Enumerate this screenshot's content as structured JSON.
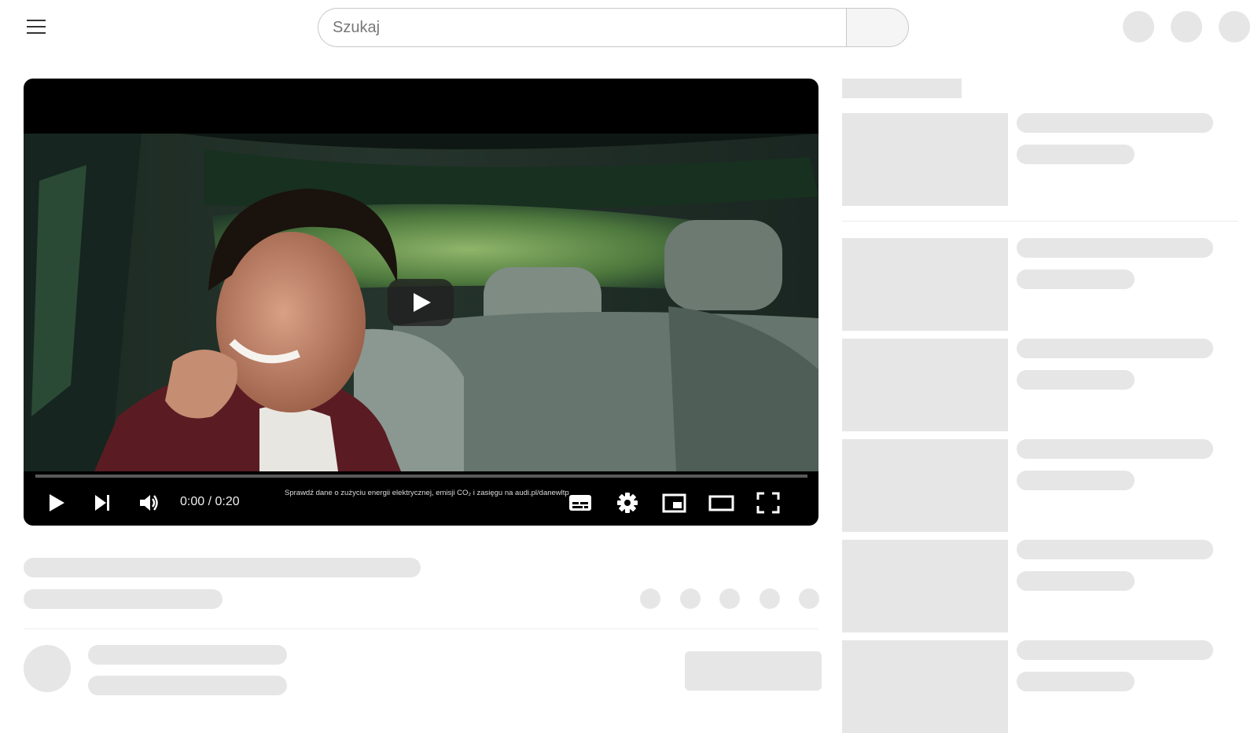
{
  "header": {
    "menu_icon": "hamburger-menu-icon",
    "search": {
      "placeholder": "Szukaj",
      "value": ""
    },
    "search_button_icon": "search-icon"
  },
  "player": {
    "time_display": "0:00 / 0:20",
    "overlay_text": "Sprawdź dane o zużyciu energii elektrycznej, emisji CO₂ i zasięgu na audi.pl/danewltp",
    "progress": 0,
    "controls": {
      "play_icon": "play-icon",
      "next_icon": "next-icon",
      "volume_icon": "volume-icon",
      "subtitles_icon": "subtitles-icon",
      "settings_icon": "gear-icon",
      "miniplayer_icon": "miniplayer-icon",
      "theater_icon": "theater-mode-icon",
      "fullscreen_icon": "fullscreen-icon"
    }
  },
  "colors": {
    "placeholder_gray": "#e6e6e6",
    "player_background": "#000000"
  }
}
